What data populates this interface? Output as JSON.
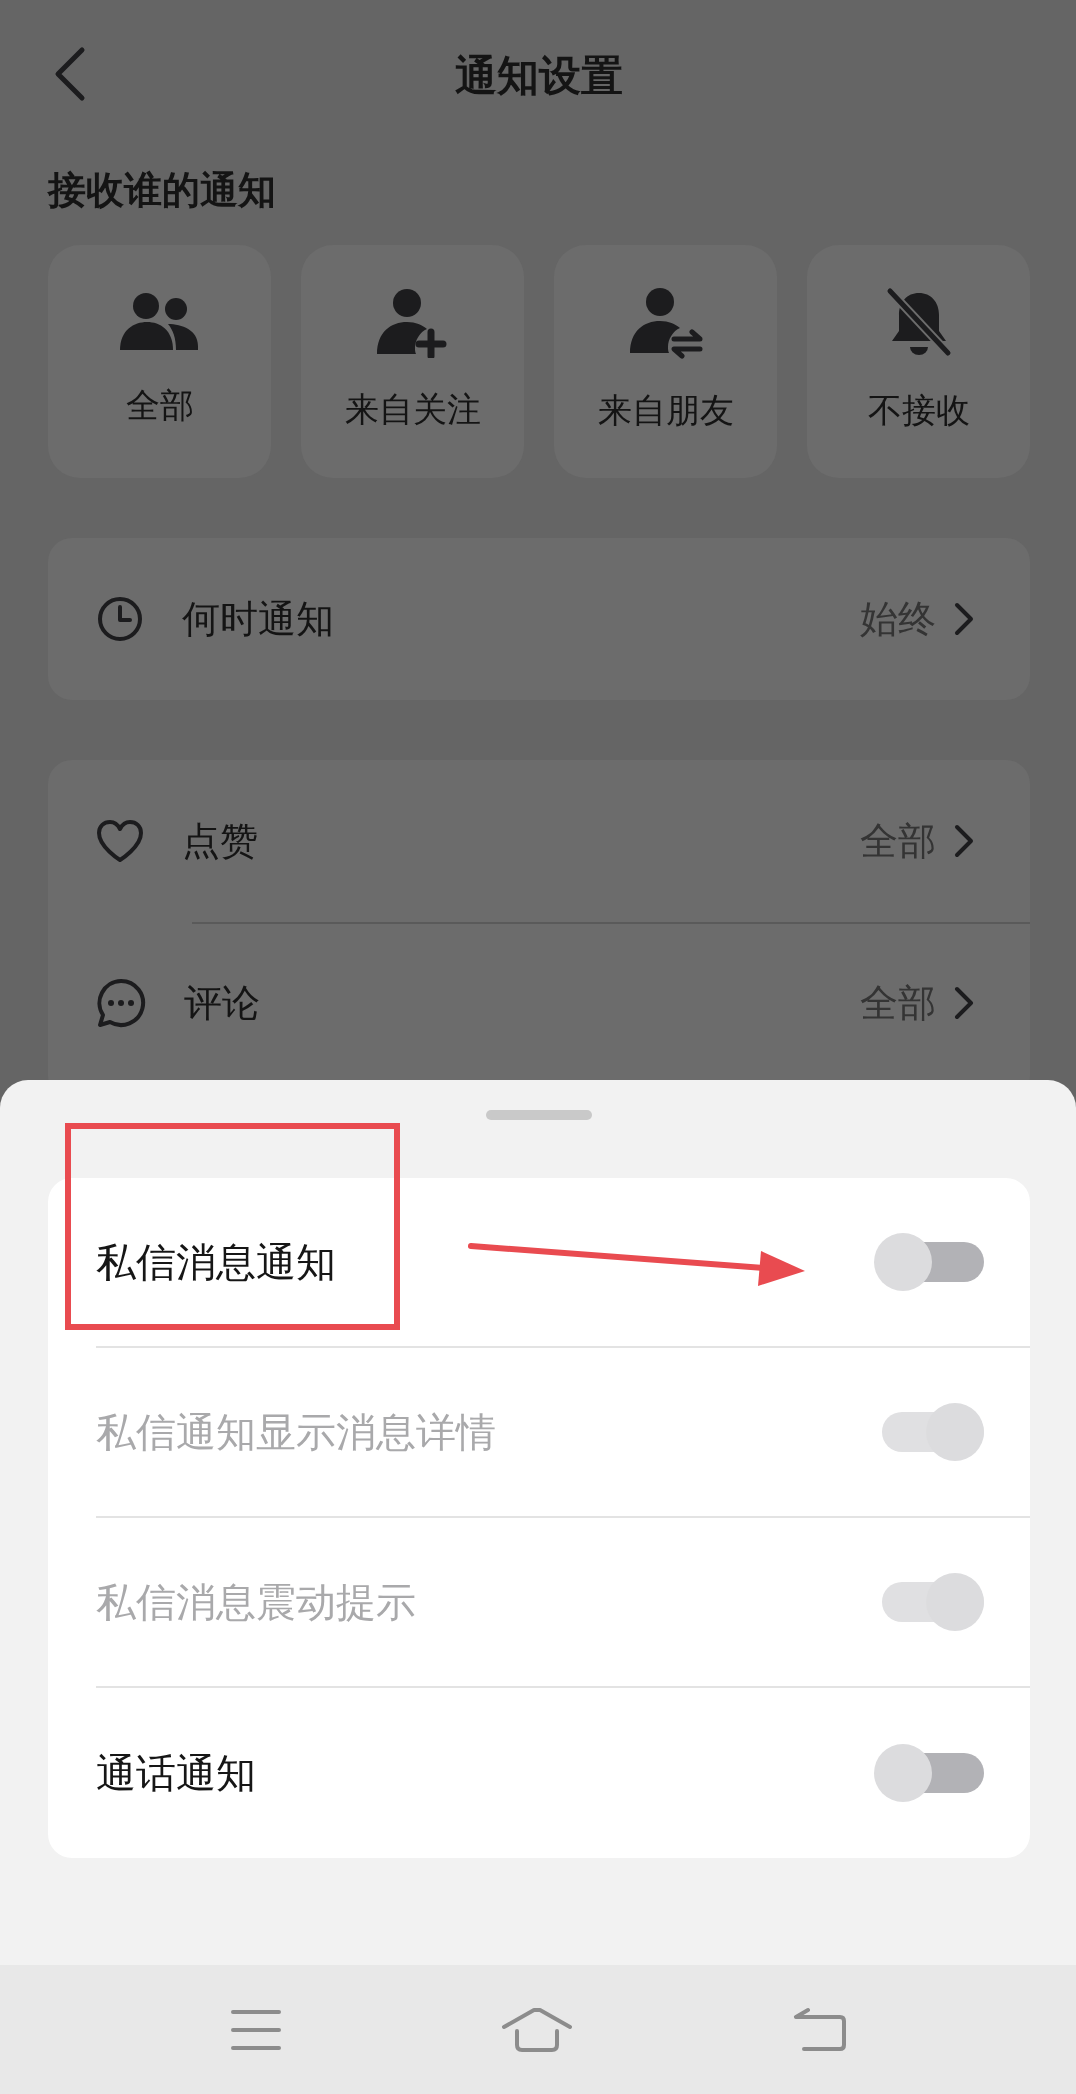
{
  "header": {
    "title": "通知设置"
  },
  "recipients": {
    "label": "接收谁的通知",
    "options": [
      {
        "kind": "group",
        "label": "全部"
      },
      {
        "kind": "person-plus",
        "label": "来自关注"
      },
      {
        "kind": "person-swap",
        "label": "来自朋友"
      },
      {
        "kind": "bell-off",
        "label": "不接收"
      }
    ]
  },
  "timing": {
    "label": "何时通知",
    "value": "始终"
  },
  "categories": [
    {
      "kind": "heart",
      "label": "点赞",
      "value": "全部"
    },
    {
      "kind": "comment",
      "label": "评论",
      "value": "全部"
    }
  ],
  "sheet": {
    "settings": [
      {
        "label": "私信消息通知",
        "on": false,
        "disabled": false
      },
      {
        "label": "私信通知显示消息详情",
        "on": true,
        "disabled": true
      },
      {
        "label": "私信消息震动提示",
        "on": true,
        "disabled": true
      },
      {
        "label": "通话通知",
        "on": false,
        "disabled": false
      }
    ]
  }
}
